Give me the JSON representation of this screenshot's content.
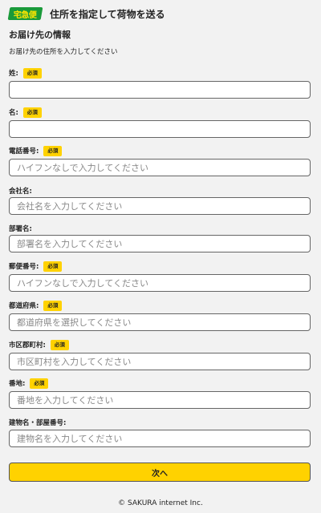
{
  "header": {
    "logo_text": "宅急便",
    "title": "住所を指定して荷物を送る"
  },
  "section": {
    "title": "お届け先の情報",
    "subtitle": "お届け先の住所を入力してください"
  },
  "required_badge": "必須",
  "fields": [
    {
      "label": "姓:",
      "required": true,
      "placeholder": ""
    },
    {
      "label": "名:",
      "required": true,
      "placeholder": ""
    },
    {
      "label": "電話番号:",
      "required": true,
      "placeholder": "ハイフンなしで入力してください"
    },
    {
      "label": "会社名:",
      "required": false,
      "placeholder": "会社名を入力してください"
    },
    {
      "label": "部署名:",
      "required": false,
      "placeholder": "部署名を入力してください"
    },
    {
      "label": "郵便番号:",
      "required": true,
      "placeholder": "ハイフンなしで入力してください"
    },
    {
      "label": "都道府県:",
      "required": true,
      "placeholder": "都道府県を選択してください"
    },
    {
      "label": "市区郡町村:",
      "required": true,
      "placeholder": "市区町村を入力してください"
    },
    {
      "label": "番地:",
      "required": true,
      "placeholder": "番地を入力してください"
    },
    {
      "label": "建物名・部屋番号:",
      "required": false,
      "placeholder": "建物名を入力してください"
    }
  ],
  "next_button": {
    "label": "次へ"
  },
  "footer": {
    "copyright": "© SAKURA internet Inc."
  },
  "colors": {
    "accent": "#ffd200",
    "logo_bg": "#1a9a3a",
    "logo_text": "#ffe600"
  }
}
